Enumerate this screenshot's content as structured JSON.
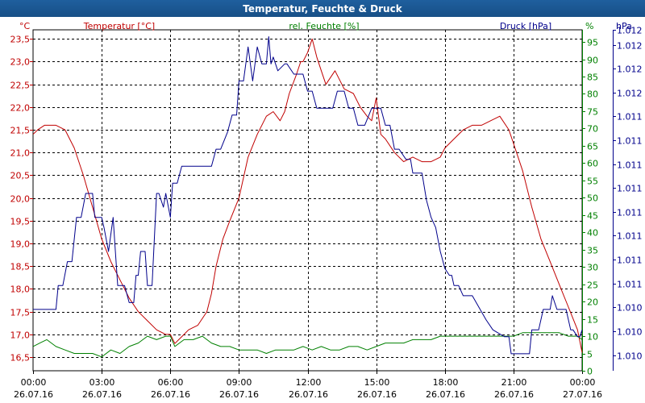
{
  "window": {
    "title": "Temperatur, Feuchte & Druck"
  },
  "chart_data": {
    "type": "line",
    "title": "Temperatur, Feuchte & Druck",
    "x_ticks": [
      {
        "t": 0,
        "time": "00:00",
        "date": "26.07.16"
      },
      {
        "t": 3,
        "time": "03:00",
        "date": "26.07.16"
      },
      {
        "t": 6,
        "time": "06:00",
        "date": "26.07.16"
      },
      {
        "t": 9,
        "time": "09:00",
        "date": "26.07.16"
      },
      {
        "t": 12,
        "time": "12:00",
        "date": "26.07.16"
      },
      {
        "t": 15,
        "time": "15:00",
        "date": "26.07.16"
      },
      {
        "t": 18,
        "time": "18:00",
        "date": "26.07.16"
      },
      {
        "t": 21,
        "time": "21:00",
        "date": "26.07.16"
      },
      {
        "t": 24,
        "time": "00:00",
        "date": "27.07.16"
      }
    ],
    "xlim": [
      0,
      24
    ],
    "grid": true,
    "axes": {
      "temp": {
        "label": "Temperatur [°C]",
        "unit": "°C",
        "color": "#c00000",
        "ylim": [
          16.2,
          23.7
        ],
        "ticks": [
          "16,5",
          "17,0",
          "17,5",
          "18,0",
          "18,5",
          "19,0",
          "19,5",
          "20,0",
          "20,5",
          "21,0",
          "21,5",
          "22,0",
          "22,5",
          "23,0",
          "23,5"
        ],
        "tick_values": [
          16.5,
          17.0,
          17.5,
          18.0,
          18.5,
          19.0,
          19.5,
          20.0,
          20.5,
          21.0,
          21.5,
          22.0,
          22.5,
          23.0,
          23.5
        ]
      },
      "hum": {
        "label": "rel. Feuchte [%]",
        "unit": "%",
        "color": "#008000",
        "ylim": [
          0,
          98.5
        ],
        "ticks": [
          "0",
          "5",
          "10",
          "15",
          "20",
          "25",
          "30",
          "35",
          "40",
          "45",
          "50",
          "55",
          "60",
          "65",
          "70",
          "75",
          "80",
          "85",
          "90",
          "95"
        ],
        "tick_values": [
          0,
          5,
          10,
          15,
          20,
          25,
          30,
          35,
          40,
          45,
          50,
          55,
          60,
          65,
          70,
          75,
          80,
          85,
          90,
          95
        ]
      },
      "press": {
        "label": "Druck [hPa]",
        "unit": "hPa",
        "color": "#00008b",
        "ylim": [
          0,
          1
        ],
        "ticks": [
          "1.010",
          "1.010",
          "1.010",
          "1.011",
          "1.011",
          "1.011",
          "1.011",
          "1.011",
          "1.011",
          "1.011",
          "1.011",
          "1.012",
          "1.012",
          "1.012",
          "1.012"
        ],
        "tick_positions": [
          0.046,
          0.116,
          0.186,
          0.256,
          0.326,
          0.396,
          0.466,
          0.536,
          0.606,
          0.676,
          0.746,
          0.816,
          0.886,
          0.956,
          1.0
        ]
      }
    },
    "series": [
      {
        "name": "Temperatur [°C]",
        "axis": "temp",
        "color": "#c00000",
        "x": [
          0,
          0.2,
          0.5,
          1.0,
          1.4,
          1.8,
          2.2,
          2.6,
          3.0,
          3.4,
          3.8,
          4.2,
          4.6,
          5.0,
          5.4,
          5.8,
          6.0,
          6.2,
          6.4,
          6.6,
          6.8,
          7.2,
          7.6,
          7.8,
          8.0,
          8.3,
          8.6,
          9.0,
          9.4,
          9.8,
          10.2,
          10.5,
          10.8,
          11.0,
          11.2,
          11.5,
          11.7,
          11.8,
          12.0,
          12.2,
          12.4,
          12.6,
          12.8,
          13.2,
          13.6,
          14.0,
          14.3,
          14.6,
          14.8,
          15.0,
          15.2,
          15.4,
          15.8,
          16.2,
          16.6,
          17.0,
          17.4,
          17.8,
          18.0,
          18.4,
          18.8,
          19.2,
          19.6,
          20.0,
          20.4,
          20.8,
          21.0,
          21.4,
          21.8,
          22.2,
          22.6,
          23.0,
          23.4,
          23.8,
          24.0
        ],
        "y": [
          21.4,
          21.5,
          21.6,
          21.6,
          21.5,
          21.1,
          20.5,
          19.8,
          19.1,
          18.6,
          18.2,
          17.8,
          17.5,
          17.3,
          17.1,
          17.0,
          17.0,
          16.8,
          16.9,
          17.0,
          17.1,
          17.2,
          17.5,
          17.9,
          18.5,
          19.1,
          19.5,
          20.0,
          20.9,
          21.4,
          21.8,
          21.9,
          21.7,
          21.9,
          22.3,
          22.7,
          23.0,
          23.0,
          23.2,
          23.5,
          23.1,
          22.8,
          22.5,
          22.8,
          22.4,
          22.3,
          22.0,
          21.8,
          21.7,
          22.2,
          21.4,
          21.3,
          21.0,
          20.8,
          20.9,
          20.8,
          20.8,
          20.9,
          21.1,
          21.3,
          21.5,
          21.6,
          21.6,
          21.7,
          21.8,
          21.5,
          21.2,
          20.6,
          19.8,
          19.1,
          18.6,
          18.1,
          17.6,
          17.1,
          16.6
        ]
      },
      {
        "name": "rel. Feuchte [%]",
        "axis": "hum",
        "color": "#008000",
        "x": [
          0,
          0.3,
          0.6,
          1.0,
          1.4,
          1.8,
          2.2,
          2.6,
          3.0,
          3.4,
          3.8,
          4.2,
          4.6,
          5.0,
          5.4,
          5.8,
          6.0,
          6.2,
          6.4,
          6.6,
          7.0,
          7.4,
          7.8,
          8.2,
          8.6,
          9.0,
          9.4,
          9.8,
          10.2,
          10.6,
          11.0,
          11.4,
          11.8,
          12.2,
          12.6,
          13.0,
          13.4,
          13.8,
          14.2,
          14.6,
          15.0,
          15.4,
          15.8,
          16.2,
          16.6,
          17.0,
          17.4,
          17.8,
          18.2,
          18.6,
          19.0,
          19.4,
          19.8,
          20.2,
          20.6,
          21.0,
          21.4,
          21.8,
          22.2,
          22.6,
          23.0,
          23.4,
          23.8,
          24.0
        ],
        "y": [
          7,
          8,
          9,
          7,
          6,
          5,
          5,
          5,
          4,
          6,
          5,
          7,
          8,
          10,
          9,
          10,
          10,
          7,
          8,
          9,
          9,
          10,
          8,
          7,
          7,
          6,
          6,
          6,
          5,
          6,
          6,
          6,
          7,
          6,
          7,
          6,
          6,
          7,
          7,
          6,
          7,
          8,
          8,
          8,
          9,
          9,
          9,
          10,
          10,
          10,
          10,
          10,
          10,
          10,
          10,
          10,
          11,
          11,
          11,
          11,
          11,
          10,
          10,
          9
        ]
      },
      {
        "name": "Druck [hPa]",
        "axis": "press",
        "color": "#00008b",
        "x": [
          0,
          0.5,
          1.0,
          1.1,
          1.3,
          1.5,
          1.7,
          1.9,
          2.1,
          2.3,
          2.6,
          2.7,
          3.0,
          3.1,
          3.3,
          3.5,
          3.6,
          3.7,
          4.0,
          4.2,
          4.4,
          4.5,
          4.6,
          4.7,
          4.9,
          5.0,
          5.2,
          5.4,
          5.5,
          5.7,
          5.8,
          6.0,
          6.1,
          6.3,
          6.5,
          6.9,
          7.1,
          7.4,
          7.8,
          8.0,
          8.2,
          8.5,
          8.7,
          8.9,
          9.0,
          9.2,
          9.4,
          9.6,
          9.8,
          10.0,
          10.2,
          10.3,
          10.4,
          10.5,
          10.7,
          11.0,
          11.1,
          11.4,
          11.8,
          12.0,
          12.2,
          12.4,
          13.1,
          13.3,
          13.6,
          13.8,
          14.0,
          14.2,
          14.5,
          14.8,
          15.2,
          15.4,
          15.6,
          15.8,
          16.0,
          16.3,
          16.5,
          16.6,
          17.0,
          17.2,
          17.4,
          17.6,
          17.8,
          18.0,
          18.2,
          18.3,
          18.4,
          18.6,
          18.8,
          19.0,
          19.2,
          19.8,
          20.1,
          20.6,
          20.8,
          20.9,
          21.2,
          21.7,
          21.8,
          22.1,
          22.3,
          22.5,
          22.6,
          22.7,
          22.9,
          23.3,
          23.5,
          23.6,
          23.8,
          23.9,
          24.0
        ],
        "y": [
          0.18,
          0.18,
          0.18,
          0.25,
          0.25,
          0.32,
          0.32,
          0.45,
          0.45,
          0.52,
          0.52,
          0.45,
          0.45,
          0.42,
          0.35,
          0.45,
          0.35,
          0.25,
          0.25,
          0.2,
          0.2,
          0.28,
          0.28,
          0.35,
          0.35,
          0.25,
          0.25,
          0.52,
          0.52,
          0.48,
          0.52,
          0.45,
          0.55,
          0.55,
          0.6,
          0.6,
          0.6,
          0.6,
          0.6,
          0.65,
          0.65,
          0.7,
          0.75,
          0.75,
          0.85,
          0.85,
          0.95,
          0.85,
          0.95,
          0.9,
          0.9,
          0.98,
          0.9,
          0.92,
          0.88,
          0.9,
          0.9,
          0.87,
          0.87,
          0.82,
          0.82,
          0.77,
          0.77,
          0.82,
          0.82,
          0.77,
          0.77,
          0.72,
          0.72,
          0.77,
          0.77,
          0.72,
          0.72,
          0.65,
          0.65,
          0.62,
          0.62,
          0.58,
          0.58,
          0.5,
          0.45,
          0.42,
          0.35,
          0.3,
          0.28,
          0.28,
          0.25,
          0.25,
          0.22,
          0.22,
          0.22,
          0.15,
          0.12,
          0.1,
          0.1,
          0.05,
          0.05,
          0.05,
          0.12,
          0.12,
          0.18,
          0.18,
          0.18,
          0.22,
          0.18,
          0.18,
          0.12,
          0.12,
          0.1,
          0.1,
          0.12
        ]
      }
    ]
  }
}
